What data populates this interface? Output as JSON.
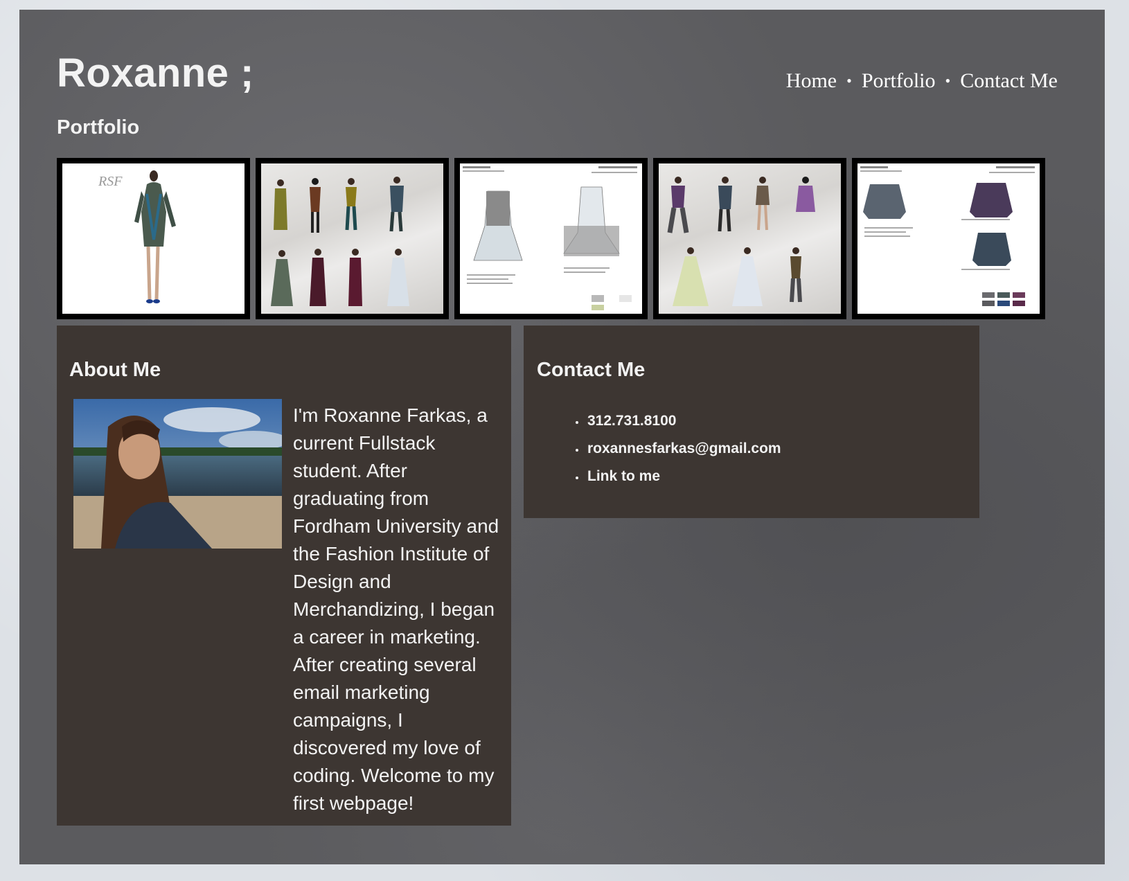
{
  "header": {
    "brand": "Roxanne ;",
    "nav": [
      {
        "label": "Home"
      },
      {
        "label": "Portfolio"
      },
      {
        "label": "Contact Me"
      }
    ],
    "separator": "•"
  },
  "portfolio": {
    "title": "Portfolio"
  },
  "about": {
    "title": "About Me",
    "text": "I'm Roxanne Farkas, a current Fullstack student. After graduating from Fordham University and the Fashion Institute of Design and Merchandizing, I began a career in marketing. After creating several email marketing campaigns, I discovered my love of coding. Welcome to my first webpage!"
  },
  "contact": {
    "title": "Contact Me",
    "items": [
      {
        "label": "312.731.8100"
      },
      {
        "label": "roxannesfarkas@gmail.com"
      },
      {
        "label": "Link to me"
      }
    ]
  },
  "colors": {
    "page_bg": "#5b5b5e",
    "panel_bg": "#3d3632",
    "text": "#f3f3f3"
  }
}
